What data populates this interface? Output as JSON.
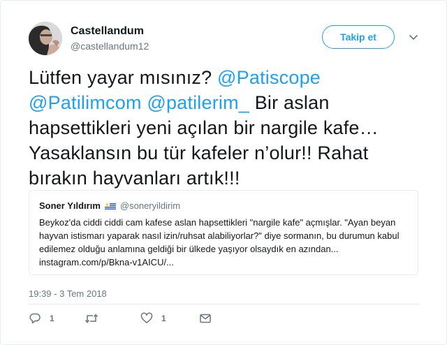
{
  "author": {
    "display_name": "Castellandum",
    "screen_name": "@castellandum12",
    "follow_label": "Takip et"
  },
  "tweet": {
    "parts": [
      {
        "text": "Lütfen yayar mısınız? ",
        "type": "text"
      },
      {
        "text": "@Patiscope",
        "type": "mention"
      },
      {
        "text": " ",
        "type": "text"
      },
      {
        "text": "@Patilimcom",
        "type": "mention"
      },
      {
        "text": " ",
        "type": "text"
      },
      {
        "text": "@patilerim_",
        "type": "mention"
      },
      {
        "text": " Bir aslan hapsettikleri yeni açılan bir nargile kafe… Yasaklansın bu tür kafeler n’olur!! Rahat bırakın hayvanları artık!!!",
        "type": "text"
      }
    ]
  },
  "quote": {
    "name": "Soner Yıldırım",
    "handle": "@soneryildirim",
    "text": "Beykoz'da ciddi ciddi cam kafese aslan hapsettikleri \"nargile kafe\" açmışlar. \"Ayan beyan hayvan istismarı yaparak nasıl izin/ruhsat alabiliyorlar?\" diye sormanın, bu durumun kabul edilemez olduğu anlamına geldiği bir ülkede yaşıyor olsaydık en azından... instagram.com/p/Bkna-v1AICU/..."
  },
  "timestamp": "19:39 - 3 Tem 2018",
  "actions": {
    "reply_count": "1",
    "retweet_count": "",
    "like_count": "1"
  },
  "icons": {
    "reply": "reply-icon",
    "retweet": "retweet-icon",
    "like": "heart-icon",
    "dm": "envelope-icon",
    "caret": "chevron-down-icon",
    "flag": "uruguay-flag-icon"
  },
  "colors": {
    "accent": "#1da1f2",
    "secondary_text": "#657786",
    "border": "#e6ecf0"
  }
}
